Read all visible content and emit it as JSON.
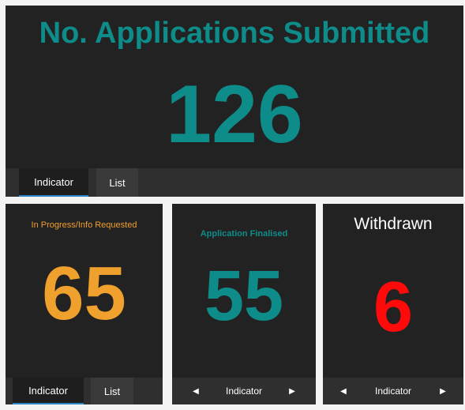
{
  "colors": {
    "teal": "#0e8c8a",
    "orange": "#f0a02c",
    "red": "#ff0a0a",
    "white": "#ffffff"
  },
  "top_panel": {
    "title": "No. Applications Submitted",
    "value": "126",
    "tabs": [
      "Indicator",
      "List"
    ],
    "active_tab": "Indicator"
  },
  "cards": [
    {
      "title": "In Progress/Info Requested",
      "value": "65",
      "color": "orange",
      "tabs": [
        "Indicator",
        "List"
      ],
      "active_tab": "Indicator"
    },
    {
      "title": "Application Finalised",
      "value": "55",
      "color": "teal",
      "nav_label": "Indicator",
      "left_arrow": "◀",
      "right_arrow": "▶"
    },
    {
      "title": "Withdrawn",
      "value": "6",
      "color": "red",
      "nav_label": "Indicator",
      "left_arrow": "◀",
      "right_arrow": "▶"
    }
  ]
}
